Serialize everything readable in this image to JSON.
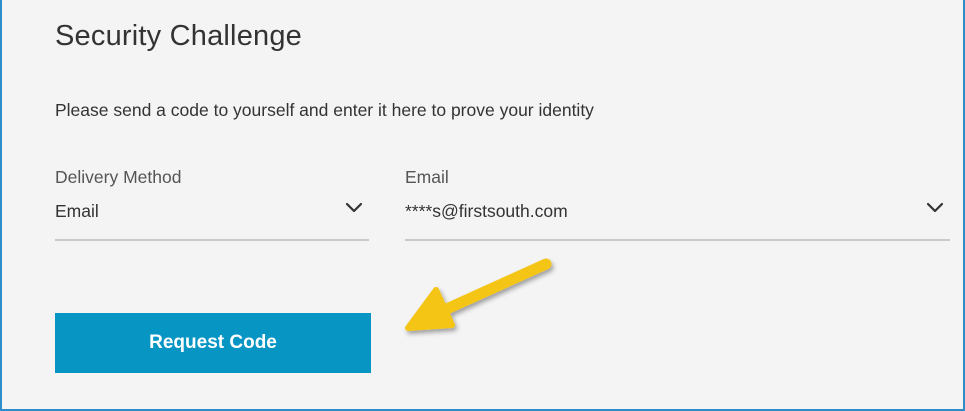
{
  "page": {
    "title": "Security Challenge",
    "instructions": "Please send a code to yourself and enter it here to prove your identity"
  },
  "delivery_method": {
    "label": "Delivery Method",
    "value": "Email",
    "icon": "chevron-down-icon"
  },
  "email": {
    "label": "Email",
    "value": "****s@firstsouth.com",
    "icon": "chevron-down-icon"
  },
  "actions": {
    "request_code_label": "Request Code"
  },
  "annotation": {
    "icon": "arrow-icon",
    "color": "#f5c518"
  },
  "colors": {
    "accent": "#0795c4",
    "frame_border": "#2e8cc8",
    "background": "#f4f4f4"
  }
}
